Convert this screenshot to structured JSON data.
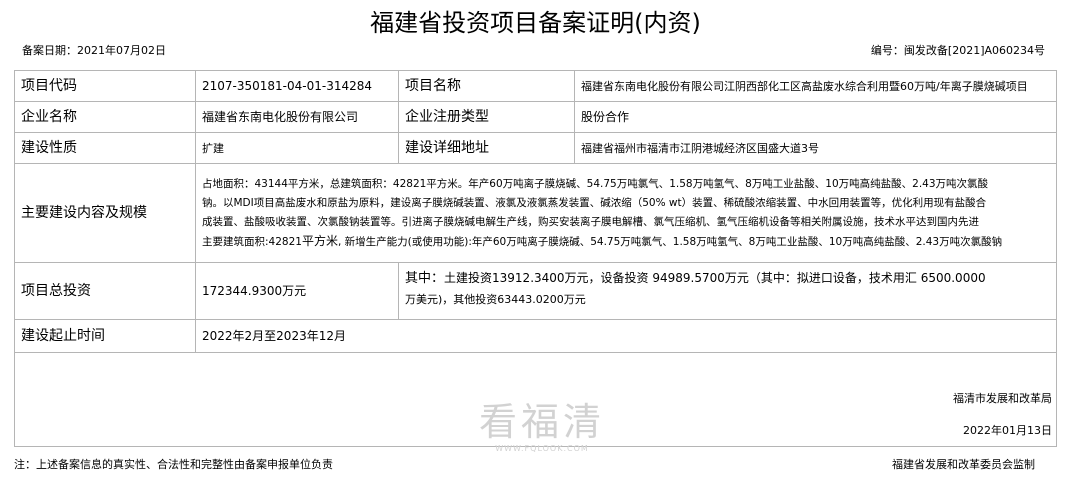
{
  "title": "福建省投资项目备案证明(内资)",
  "filing_date_label": "备案日期：",
  "filing_date": "2021年07月02日",
  "doc_no_label": "编号：",
  "doc_no": "闽发改备[2021]A060234号",
  "rows": {
    "project_code_label": "项目代码",
    "project_code": "2107-350181-04-01-314284",
    "project_name_label": "项目名称",
    "project_name": "福建省东南电化股份有限公司江阴西部化工区高盐废水综合利用暨60万吨/年离子膜烧碱项目",
    "company_label": "企业名称",
    "company": "福建省东南电化股份有限公司",
    "reg_type_label": "企业注册类型",
    "reg_type": "股份合作",
    "nature_label": "建设性质",
    "nature": "扩建",
    "address_label": "建设详细地址",
    "address": "福建省福州市福清市江阴港城经济区国盛大道3号",
    "content_label": "主要建设内容及规模",
    "content_line1": "占地面积：43144平方米，总建筑面积：42821平方米。年产60万吨离子膜烧碱、54.75万吨氯气、1.58万吨氢气、8万吨工业盐酸、10万吨高纯盐酸、2.43万吨次氯酸",
    "content_line2": "钠。以MDI项目高盐废水和原盐为原料，建设离子膜烧碱装置、液氯及液氯蒸发装置、碱浓缩（50% wt）装置、稀硫酸浓缩装置、中水回用装置等，优化利用现有盐酸合",
    "content_line3": "成装置、盐酸吸收装置、次氯酸钠装置等。引进离子膜烧碱电解生产线，购买安装离子膜电解槽、氯气压缩机、氢气压缩机设备等相关附属设施，技术水平达到国内先进",
    "content_line4_a": "主要建筑面积:42821",
    "content_line4_b": "平方米",
    "content_line4_c": ", 新增生产能力(或使用功能):年产60万吨离子膜烧碱、54.75万吨氯气、1.58万吨氢气、8万吨工业盐酸、10万吨高纯盐酸、2.43万吨次氯酸钠",
    "investment_label": "项目总投资",
    "investment": "172344.9300万元",
    "invest_detail_prefix": "其中：",
    "invest_detail_main": "土建投资13912.3400万元，设备投资 94989.5700万元（其中：拟进口设备，技术用汇 6500.0000",
    "invest_detail_line2": "万美元)，其他投资63443.0200万元",
    "period_label": "建设起止时间",
    "period": "2022年2月至2023年12月"
  },
  "agency": "福清市发展和改革局",
  "sign_date": "2022年01月13日",
  "watermark": {
    "text": "看福清",
    "url": "WWW.FQLOOK.COM"
  },
  "footnote": "注：上述备案信息的真实性、合法性和完整性由备案申报单位负责",
  "supervisor": "福建省发展和改革委员会监制"
}
